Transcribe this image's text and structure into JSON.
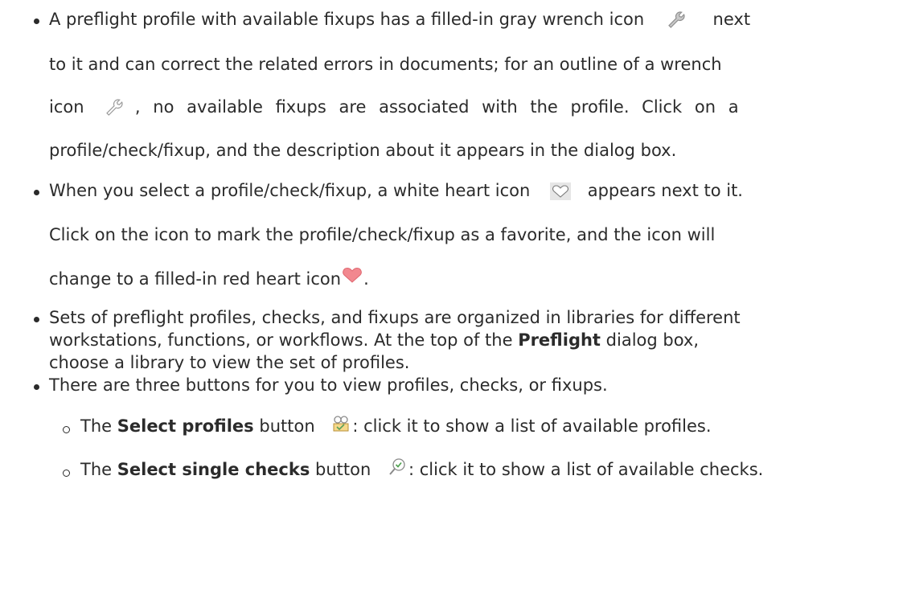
{
  "bullet1": {
    "l1a": "A preflight profile with available fixups has a filled-in gray wrench icon",
    "l1b": "next",
    "l2": "to it and can correct the related errors in documents; for an outline of a wrench",
    "l3a": "icon",
    "l3b": ", no available fixups are associated with the profile. Click on a",
    "l4": "profile/check/fixup, and the description about it appears in the dialog box."
  },
  "bullet2": {
    "l1a": "When you select a profile/check/fixup, a white heart icon",
    "l1b": "appears next to it.",
    "l2": "Click on the icon to mark the profile/check/fixup as a favorite, and the icon will",
    "l3a": "change to a filled-in red heart icon",
    "l3b": "."
  },
  "bullet3": {
    "l1": "Sets of preflight profiles, checks, and fixups are organized in libraries for different",
    "l2a": "workstations, functions, or workflows. At the top of the",
    "l2b": "Preflight",
    "l2c": "dialog box,",
    "l3": "choose a library to view the set of profiles."
  },
  "bullet4": {
    "l1": "There are three buttons for you to view profiles, checks, or fixups."
  },
  "sub1": {
    "pre": "The",
    "bold": "Select profiles",
    "mid": "button",
    "post": ": click it to show a list of available profiles."
  },
  "sub2": {
    "pre": "The",
    "bold": "Select single checks",
    "mid": "button",
    "post": ": click it to show a list of available checks."
  },
  "icons": {
    "wrench_filled": "wrench-filled-gray",
    "wrench_outline": "wrench-outline",
    "heart_white": "heart-white",
    "heart_red": "heart-red",
    "select_profiles": "select-profiles-icon",
    "select_checks": "select-checks-icon"
  },
  "colors": {
    "text": "#2b2b2b",
    "heart_red": "#f2888f",
    "wrench_gray": "#a9a9a9"
  }
}
